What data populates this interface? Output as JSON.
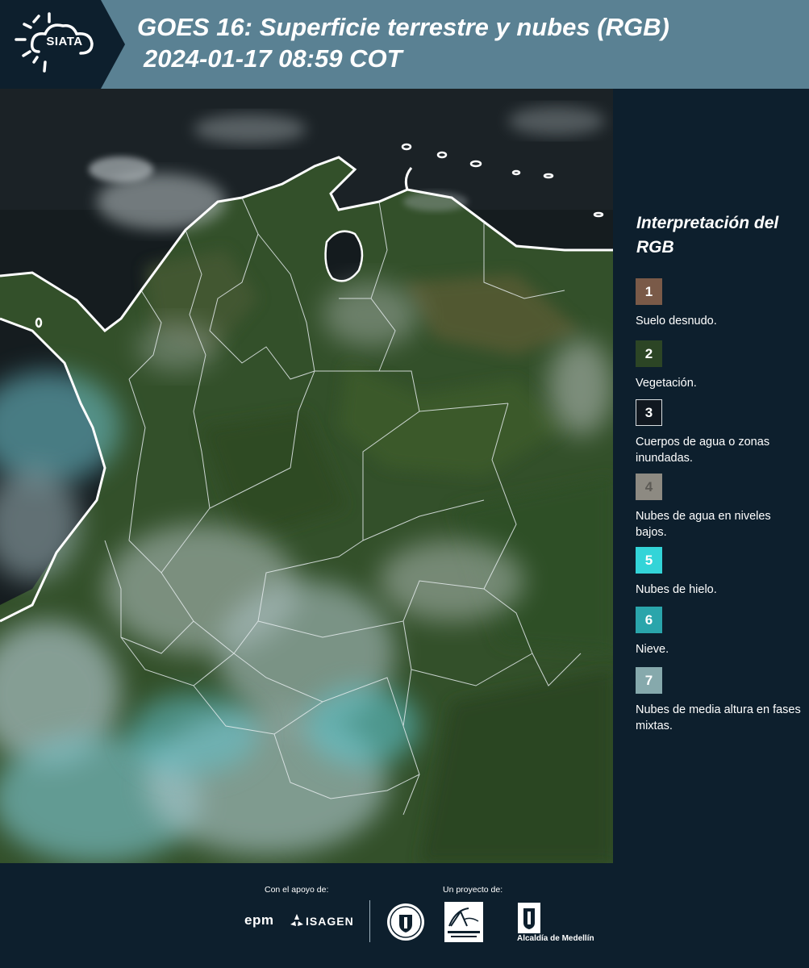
{
  "header": {
    "logo_text": "SIATA",
    "title": "GOES 16: Superficie terrestre y nubes (RGB)",
    "datetime": "2024-01-17 08:59 COT"
  },
  "legend": {
    "title": "Interpretación del RGB",
    "items": [
      {
        "number": "1",
        "label": "Suelo desnudo.",
        "color": "#7a5a48",
        "text_color": "#ffffff",
        "border": "#7a5a48"
      },
      {
        "number": "2",
        "label": "Vegetación.",
        "color": "#2c4525",
        "text_color": "#ffffff",
        "border": "#2c4525"
      },
      {
        "number": "3",
        "label": "Cuerpos de agua o zonas inundadas.",
        "color": "#111820",
        "text_color": "#ffffff",
        "border": "#d8dde0"
      },
      {
        "number": "4",
        "label": "Nubes de agua en niveles bajos.",
        "color": "#8d8a82",
        "text_color": "#5c5a55",
        "border": "#8d8a82"
      },
      {
        "number": "5",
        "label": "Nubes de hielo.",
        "color": "#33d4d8",
        "text_color": "#ffffff",
        "border": "#33d4d8"
      },
      {
        "number": "6",
        "label": "Nieve.",
        "color": "#2aa5ab",
        "text_color": "#ffffff",
        "border": "#2aa5ab"
      },
      {
        "number": "7",
        "label": "Nubes de media altura en fases mixtas.",
        "color": "#86a9ac",
        "text_color": "#ffffff",
        "border": "#86a9ac"
      }
    ]
  },
  "footer": {
    "support_caption": "Con el apoyo de:",
    "project_caption": "Un proyecto de:",
    "epm_label": "epm",
    "isagen_label": "ISAGEN",
    "alcaldia_label": "Alcaldía de Medellín"
  },
  "colors": {
    "header_bg": "#5a8193",
    "panel_bg": "#0d1f2d",
    "ocean": "#141b1d",
    "vegetation": "#3a5a2e",
    "ice_clouds": "#6fb8c0"
  }
}
